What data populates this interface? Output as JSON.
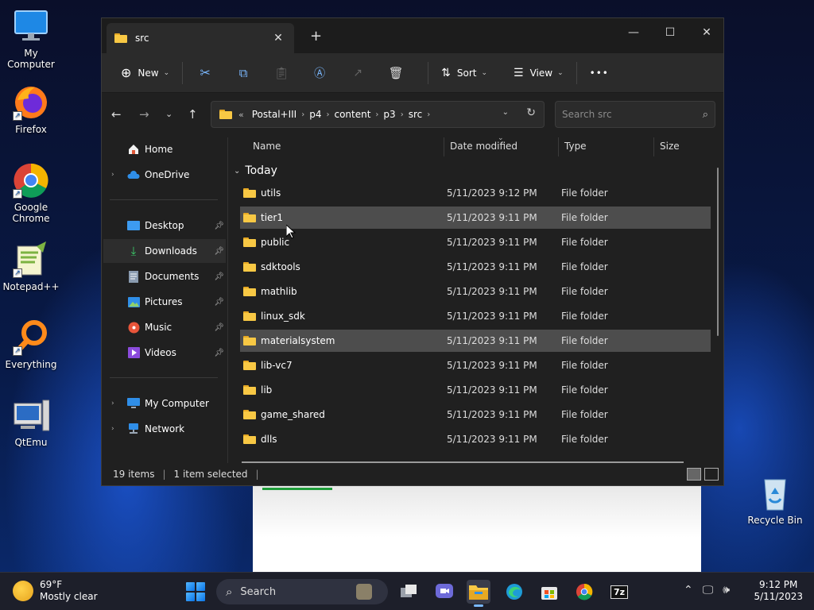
{
  "desktop": {
    "icons": [
      {
        "label": "My Computer"
      },
      {
        "label": "Firefox"
      },
      {
        "label": "Google Chrome"
      },
      {
        "label": "Notepad++"
      },
      {
        "label": "Everything"
      },
      {
        "label": "QtEmu"
      },
      {
        "label": "Recycle Bin"
      }
    ]
  },
  "window": {
    "tab_title": "src",
    "toolbar": {
      "new_label": "New",
      "sort_label": "Sort",
      "view_label": "View",
      "more_label": "•••"
    },
    "address": {
      "overflow": "«",
      "crumbs": [
        "Postal+III",
        "p4",
        "content",
        "p3",
        "src"
      ]
    },
    "search": {
      "placeholder": "Search src"
    },
    "nav": {
      "items": [
        {
          "label": "Home"
        },
        {
          "label": "OneDrive"
        },
        {
          "label": "Desktop"
        },
        {
          "label": "Downloads"
        },
        {
          "label": "Documents"
        },
        {
          "label": "Pictures"
        },
        {
          "label": "Music"
        },
        {
          "label": "Videos"
        },
        {
          "label": "My Computer"
        },
        {
          "label": "Network"
        }
      ]
    },
    "columns": {
      "name": "Name",
      "date": "Date modified",
      "type": "Type",
      "size": "Size"
    },
    "group": "Today",
    "files": [
      {
        "name": "utils",
        "date": "5/11/2023 9:12 PM",
        "type": "File folder"
      },
      {
        "name": "tier1",
        "date": "5/11/2023 9:11 PM",
        "type": "File folder"
      },
      {
        "name": "public",
        "date": "5/11/2023 9:11 PM",
        "type": "File folder"
      },
      {
        "name": "sdktools",
        "date": "5/11/2023 9:11 PM",
        "type": "File folder"
      },
      {
        "name": "mathlib",
        "date": "5/11/2023 9:11 PM",
        "type": "File folder"
      },
      {
        "name": "linux_sdk",
        "date": "5/11/2023 9:11 PM",
        "type": "File folder"
      },
      {
        "name": "materialsystem",
        "date": "5/11/2023 9:11 PM",
        "type": "File folder"
      },
      {
        "name": "lib-vc7",
        "date": "5/11/2023 9:11 PM",
        "type": "File folder"
      },
      {
        "name": "lib",
        "date": "5/11/2023 9:11 PM",
        "type": "File folder"
      },
      {
        "name": "game_shared",
        "date": "5/11/2023 9:11 PM",
        "type": "File folder"
      },
      {
        "name": "dlls",
        "date": "5/11/2023 9:11 PM",
        "type": "File folder"
      }
    ],
    "status": {
      "items": "19 items",
      "selected": "1 item selected"
    }
  },
  "taskbar": {
    "weather_temp": "69°F",
    "weather_desc": "Mostly clear",
    "search_label": "Search",
    "time": "9:12 PM",
    "date": "5/11/2023",
    "archive_label": "7z"
  },
  "colors": {
    "accent": "#0a74e6",
    "folder": "#f8c844",
    "highlight": "#4d4d4d"
  }
}
